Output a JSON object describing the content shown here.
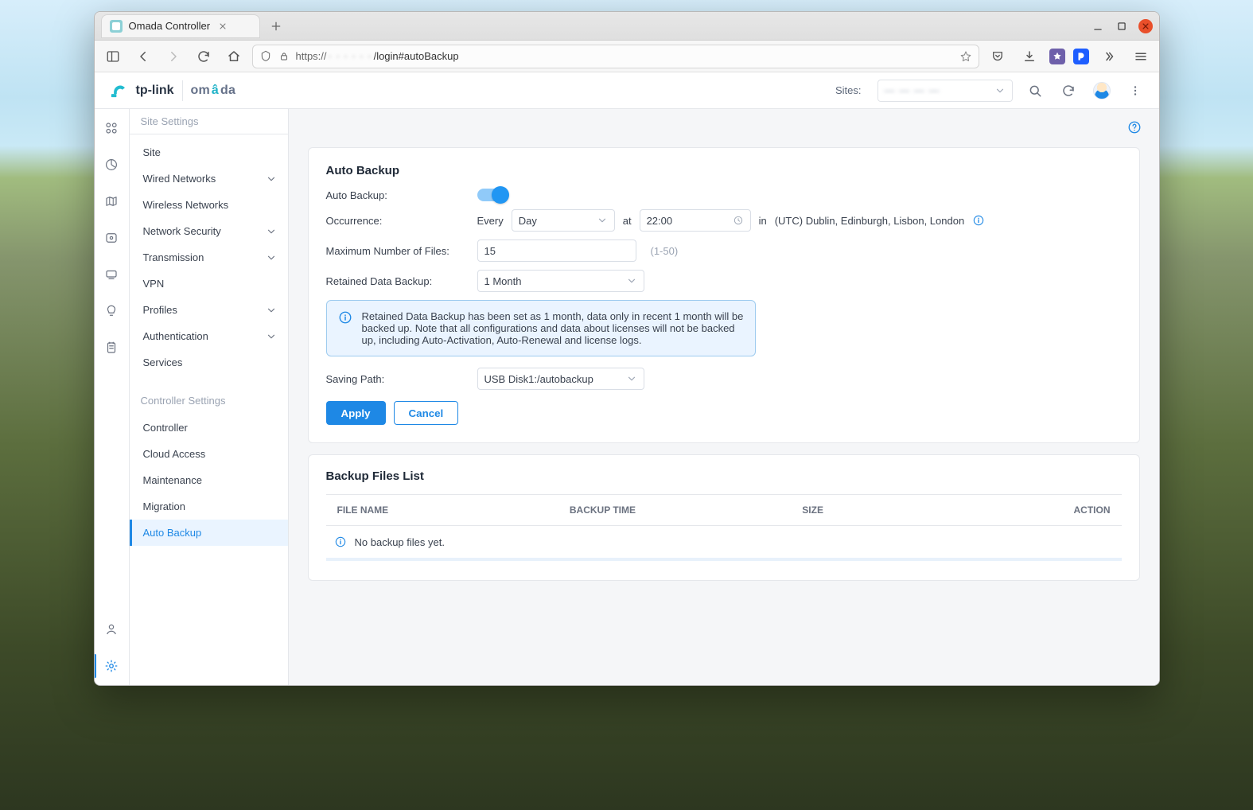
{
  "browser": {
    "tab_title": "Omada Controller",
    "url": {
      "proto": "https://",
      "host_masked": "· · · · · ·",
      "path": "/login#autoBackup"
    }
  },
  "header": {
    "sites_label": "Sites:",
    "site_selected_masked": "— — — —"
  },
  "sidebar": {
    "group_site": "Site Settings",
    "items_site": [
      {
        "label": "Site",
        "expandable": false
      },
      {
        "label": "Wired Networks",
        "expandable": true
      },
      {
        "label": "Wireless Networks",
        "expandable": false
      },
      {
        "label": "Network Security",
        "expandable": true
      },
      {
        "label": "Transmission",
        "expandable": true
      },
      {
        "label": "VPN",
        "expandable": false
      },
      {
        "label": "Profiles",
        "expandable": true
      },
      {
        "label": "Authentication",
        "expandable": true
      },
      {
        "label": "Services",
        "expandable": false
      }
    ],
    "group_controller": "Controller Settings",
    "items_controller": [
      {
        "label": "Controller"
      },
      {
        "label": "Cloud Access"
      },
      {
        "label": "Maintenance"
      },
      {
        "label": "Migration"
      },
      {
        "label": "Auto Backup",
        "active": true
      }
    ]
  },
  "autobackup": {
    "title": "Auto Backup",
    "labels": {
      "auto_backup": "Auto Backup:",
      "occurrence": "Occurrence:",
      "every": "Every",
      "at": "at",
      "in": "in",
      "timezone": "(UTC) Dublin, Edinburgh, Lisbon, London",
      "max_files": "Maximum Number of Files:",
      "range_hint": "(1-50)",
      "retained": "Retained Data Backup:",
      "saving_path": "Saving Path:",
      "apply": "Apply",
      "cancel": "Cancel"
    },
    "values": {
      "enabled": true,
      "interval_unit": "Day",
      "time": "22:00",
      "max_files": "15",
      "retained": "1 Month",
      "saving_path": "USB Disk1:/autobackup"
    },
    "info_text": "Retained Data Backup has been set as 1 month, data only in recent 1 month will be backed up. Note that all configurations and data about licenses will not be backed up, including Auto-Activation, Auto-Renewal and license logs."
  },
  "files": {
    "title": "Backup Files List",
    "columns": {
      "file": "FILE NAME",
      "time": "BACKUP TIME",
      "size": "SIZE",
      "action": "ACTION"
    },
    "empty_text": "No backup files yet."
  }
}
